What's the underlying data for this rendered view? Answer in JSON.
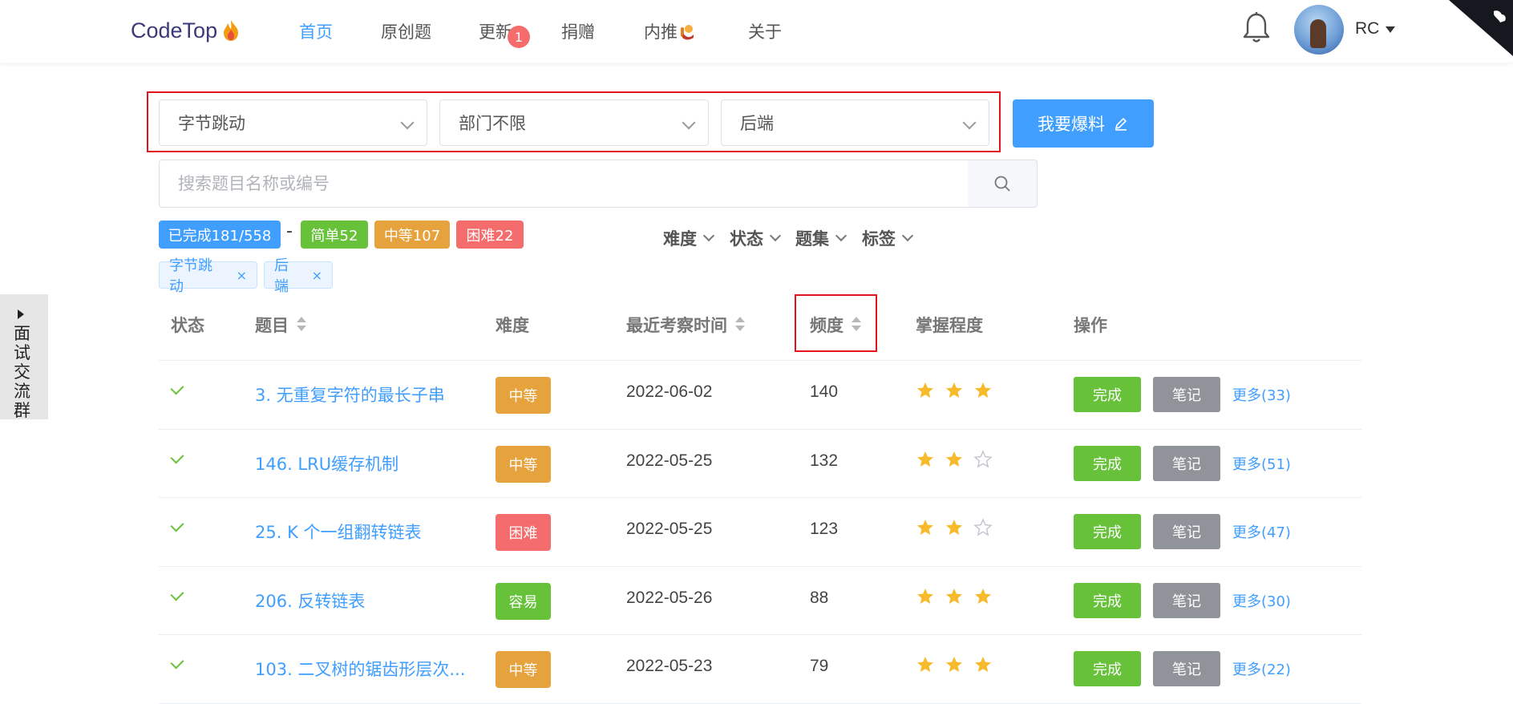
{
  "brand": {
    "name": "CodeTop"
  },
  "nav": {
    "items": [
      {
        "label": "首页",
        "active": true
      },
      {
        "label": "原创题"
      },
      {
        "label": "更新",
        "badge": "1"
      },
      {
        "label": "捐赠"
      },
      {
        "label": "内推"
      },
      {
        "label": "关于"
      }
    ]
  },
  "user": {
    "name": "RC"
  },
  "filters": {
    "company": "字节跳动",
    "department": "部门不限",
    "position": "后端",
    "report_label": "我要爆料"
  },
  "search": {
    "placeholder": "搜索题目名称或编号"
  },
  "stats": {
    "completed": "已完成181/558",
    "dash": "-",
    "easy": "简单52",
    "medium": "中等107",
    "hard": "困难22"
  },
  "dropdowns": [
    "难度",
    "状态",
    "题集",
    "标签"
  ],
  "tags": [
    "字节跳动",
    "后端"
  ],
  "side_panel": {
    "label": "面试交流群"
  },
  "table": {
    "headers": {
      "status": "状态",
      "title": "题目",
      "difficulty": "难度",
      "last_seen": "最近考察时间",
      "frequency": "频度",
      "mastery": "掌握程度",
      "actions": "操作"
    },
    "rows": [
      {
        "title": "3. 无重复字符的最长子串",
        "difficulty": "中等",
        "diff_color": "#e6a23c",
        "date": "2022-06-02",
        "freq": "140",
        "stars": 3,
        "done": "完成",
        "note": "笔记",
        "more": "更多(33)"
      },
      {
        "title": "146. LRU缓存机制",
        "difficulty": "中等",
        "diff_color": "#e6a23c",
        "date": "2022-05-25",
        "freq": "132",
        "stars": 2,
        "done": "完成",
        "note": "笔记",
        "more": "更多(51)"
      },
      {
        "title": "25. K 个一组翻转链表",
        "difficulty": "困难",
        "diff_color": "#f56c6c",
        "date": "2022-05-25",
        "freq": "123",
        "stars": 2,
        "done": "完成",
        "note": "笔记",
        "more": "更多(47)"
      },
      {
        "title": "206. 反转链表",
        "difficulty": "容易",
        "diff_color": "#67c23a",
        "date": "2022-05-26",
        "freq": "88",
        "stars": 3,
        "done": "完成",
        "note": "笔记",
        "more": "更多(30)"
      },
      {
        "title": "103. 二叉树的锯齿形层次...",
        "difficulty": "中等",
        "diff_color": "#e6a23c",
        "date": "2022-05-23",
        "freq": "79",
        "stars": 3,
        "done": "完成",
        "note": "笔记",
        "more": "更多(22)"
      }
    ]
  },
  "colors": {
    "primary": "#409eff",
    "success": "#67c23a",
    "warning": "#e6a23c",
    "danger": "#f56c6c",
    "info": "#909399",
    "highlight_box": "#e3141b",
    "star": "#f7ba2a"
  },
  "icons": [
    "flame-icon",
    "bell-icon",
    "search-icon",
    "edit-icon",
    "github-corner-icon",
    "check-icon",
    "star-icon",
    "star-outline-icon",
    "sort-icon",
    "chevron-down-icon",
    "close-icon",
    "caret-right-icon"
  ]
}
